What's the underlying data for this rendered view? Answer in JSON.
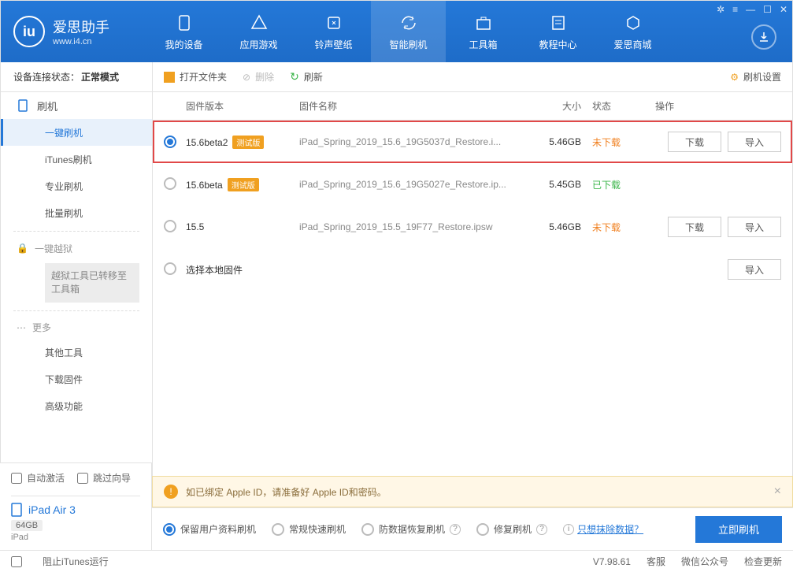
{
  "app": {
    "title": "爱思助手",
    "subtitle": "www.i4.cn"
  },
  "nav": [
    {
      "label": "我的设备"
    },
    {
      "label": "应用游戏"
    },
    {
      "label": "铃声壁纸"
    },
    {
      "label": "智能刷机",
      "active": true
    },
    {
      "label": "工具箱"
    },
    {
      "label": "教程中心"
    },
    {
      "label": "爱思商城"
    }
  ],
  "status": {
    "prefix": "设备连接状态：",
    "value": "正常模式"
  },
  "toolbar": {
    "open_folder": "打开文件夹",
    "delete": "删除",
    "refresh": "刷新",
    "settings": "刷机设置"
  },
  "sidebar": {
    "flash": "刷机",
    "items": [
      "一键刷机",
      "iTunes刷机",
      "专业刷机",
      "批量刷机"
    ],
    "jailbreak": "一键越狱",
    "jailbreak_note": "越狱工具已转移至工具箱",
    "more": "更多",
    "more_items": [
      "其他工具",
      "下载固件",
      "高级功能"
    ]
  },
  "table": {
    "headers": {
      "version": "固件版本",
      "name": "固件名称",
      "size": "大小",
      "status": "状态",
      "action": "操作"
    },
    "rows": [
      {
        "selected": true,
        "version": "15.6beta2",
        "beta": "测试版",
        "name": "iPad_Spring_2019_15.6_19G5037d_Restore.i...",
        "size": "5.46GB",
        "status": "未下载",
        "status_class": "orange",
        "download": true,
        "import": true,
        "highlight": true
      },
      {
        "selected": false,
        "version": "15.6beta",
        "beta": "测试版",
        "name": "iPad_Spring_2019_15.6_19G5027e_Restore.ip...",
        "size": "5.45GB",
        "status": "已下载",
        "status_class": "green",
        "download": false,
        "import": false
      },
      {
        "selected": false,
        "version": "15.5",
        "beta": "",
        "name": "iPad_Spring_2019_15.5_19F77_Restore.ipsw",
        "size": "5.46GB",
        "status": "未下载",
        "status_class": "orange",
        "download": true,
        "import": true
      },
      {
        "selected": false,
        "version": "选择本地固件",
        "beta": "",
        "name": "",
        "size": "",
        "status": "",
        "status_class": "",
        "download": false,
        "import": true
      }
    ],
    "btn_download": "下载",
    "btn_import": "导入"
  },
  "side_bottom": {
    "auto_activate": "自动激活",
    "skip_guide": "跳过向导",
    "device_name": "iPad Air 3",
    "device_cap": "64GB",
    "device_type": "iPad"
  },
  "alert": {
    "text": "如已绑定 Apple ID，请准备好 Apple ID和密码。"
  },
  "options": {
    "opt1": "保留用户资料刷机",
    "opt2": "常规快速刷机",
    "opt3": "防数据恢复刷机",
    "opt4": "修复刷机",
    "link": "只想抹除数据？",
    "submit": "立即刷机"
  },
  "footer": {
    "stop_itunes": "阻止iTunes运行",
    "version": "V7.98.61",
    "svc": "客服",
    "wechat": "微信公众号",
    "update": "检查更新"
  }
}
